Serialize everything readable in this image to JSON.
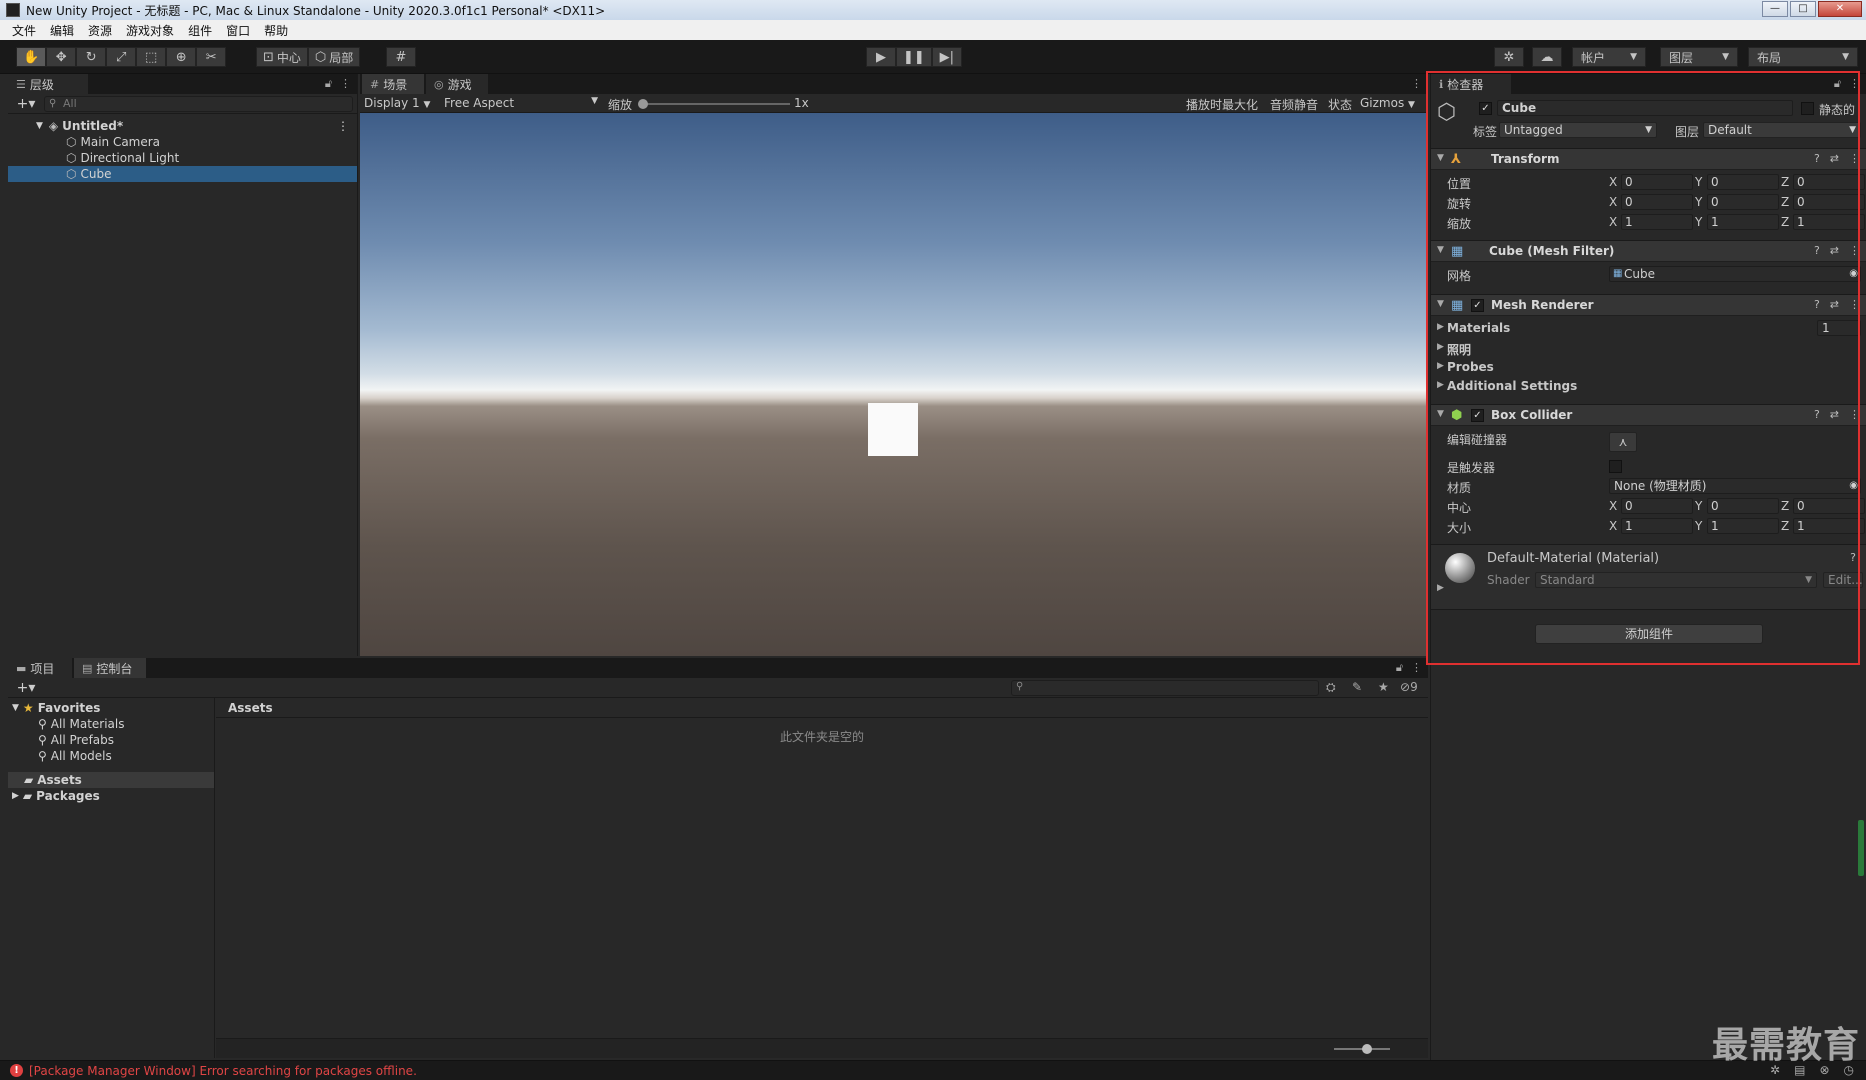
{
  "window": {
    "title": "New Unity Project - 无标题 - PC, Mac & Linux Standalone - Unity 2020.3.0f1c1 Personal* <DX11>",
    "min": "—",
    "max": "□",
    "close": "✕"
  },
  "menu": [
    "文件",
    "编辑",
    "资源",
    "游戏对象",
    "组件",
    "窗口",
    "帮助"
  ],
  "toolbar": {
    "pivot": "中心",
    "space": "局部",
    "account": "帐户",
    "layers": "图层",
    "layout": "布局"
  },
  "hierarchy": {
    "tab": "层级",
    "search_placeholder": "All",
    "scene": "Untitled*",
    "items": [
      "Main Camera",
      "Directional Light",
      "Cube"
    ],
    "selected": "Cube"
  },
  "game": {
    "tab_scene": "场景",
    "tab_game": "游戏",
    "display": "Display 1",
    "aspect": "Free Aspect",
    "scale_label": "缩放",
    "scale_value": "1x",
    "maximize": "播放时最大化",
    "mute": "音频静音",
    "stats": "状态",
    "gizmos": "Gizmos"
  },
  "project": {
    "tab_project": "项目",
    "tab_console": "控制台",
    "favorites": "Favorites",
    "fav_items": [
      "All Materials",
      "All Prefabs",
      "All Models"
    ],
    "assets": "Assets",
    "packages": "Packages",
    "assets_header": "Assets",
    "empty": "此文件夹是空的",
    "hidden_count": "9"
  },
  "status": {
    "error": "[Package Manager Window] Error searching for packages offline."
  },
  "watermark": "最需教育",
  "inspector": {
    "tab": "检查器",
    "object_name": "Cube",
    "static_label": "静态的",
    "tag_label": "标签",
    "tag_value": "Untagged",
    "layer_label": "图层",
    "layer_value": "Default",
    "transform": {
      "title": "Transform",
      "position_label": "位置",
      "rotation_label": "旋转",
      "scale_label": "缩放",
      "position": [
        "0",
        "0",
        "0"
      ],
      "rotation": [
        "0",
        "0",
        "0"
      ],
      "scale": [
        "1",
        "1",
        "1"
      ]
    },
    "mesh_filter": {
      "title": "Cube (Mesh Filter)",
      "mesh_label": "网格",
      "mesh_value": "Cube"
    },
    "mesh_renderer": {
      "title": "Mesh Renderer",
      "materials": "Materials",
      "materials_count": "1",
      "lighting": "照明",
      "probes": "Probes",
      "additional": "Additional Settings"
    },
    "box_collider": {
      "title": "Box Collider",
      "edit_label": "编辑碰撞器",
      "trigger_label": "是触发器",
      "material_label": "材质",
      "material_value": "None (物理材质)",
      "center_label": "中心",
      "size_label": "大小",
      "center": [
        "0",
        "0",
        "0"
      ],
      "size": [
        "1",
        "1",
        "1"
      ]
    },
    "material": {
      "title": "Default-Material (Material)",
      "shader_label": "Shader",
      "shader_value": "Standard",
      "edit": "Edit..."
    },
    "add_component": "添加组件"
  },
  "colors": {
    "selection": "#2c5d87",
    "highlight_border": "#e03030",
    "error_text": "#e04545"
  }
}
